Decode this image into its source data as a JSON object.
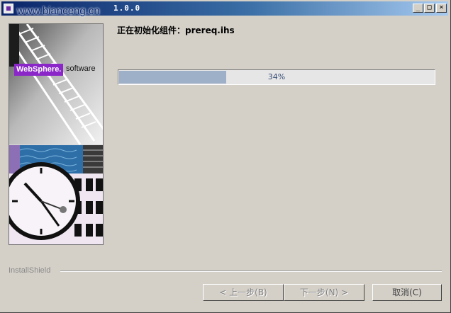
{
  "window": {
    "title": "1.0.0",
    "watermark": "www.bianceng.cn",
    "controls": {
      "minimize": "_",
      "maximize": "□",
      "close": "×"
    }
  },
  "banner": {
    "logo_text": "WebSphere.",
    "software_text": "software",
    "accent_color": "#8b27c8"
  },
  "status": {
    "message": "正在初始化组件：prereq.ihs"
  },
  "progress": {
    "percent": 34,
    "label": "34%",
    "fill_color": "#9eb0c8"
  },
  "footer": {
    "brand": "InstallShield",
    "buttons": {
      "back": "< 上一步(B)",
      "next": "下一步(N) >",
      "cancel": "取消(C)"
    }
  }
}
